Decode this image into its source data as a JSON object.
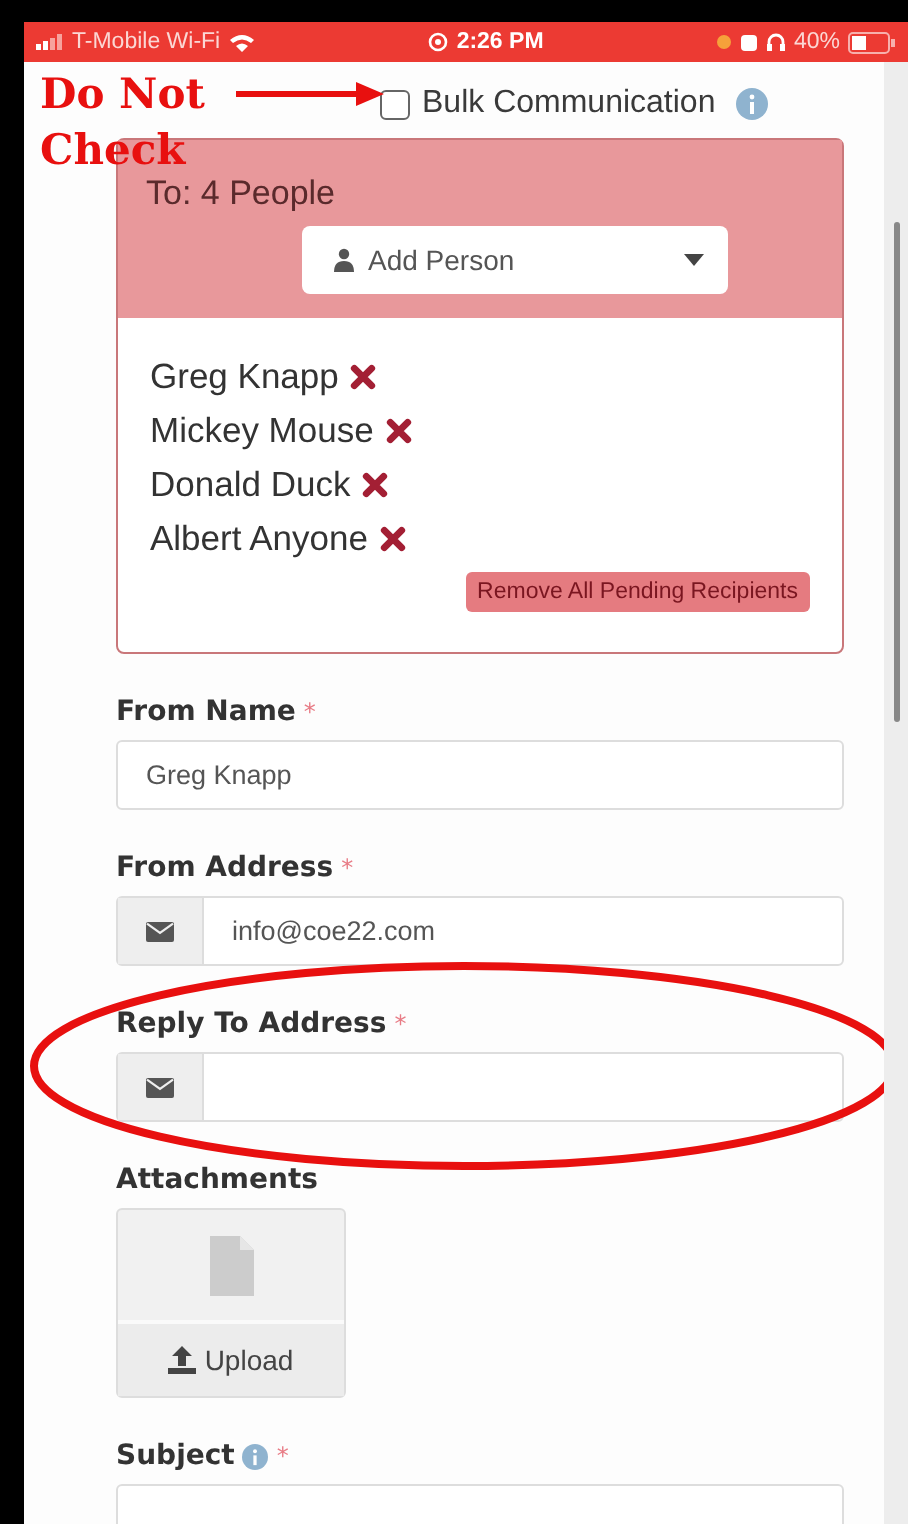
{
  "status_bar": {
    "carrier": "T-Mobile Wi-Fi",
    "time": "2:26 PM",
    "battery": "40%"
  },
  "annotation": {
    "note": "Do Not Check"
  },
  "bulk_communication": {
    "label": "Bulk Communication",
    "checked": false,
    "info": true
  },
  "recipients": {
    "title": "To: 4 People",
    "add_person": "Add Person",
    "people": [
      {
        "name": "Greg Knapp"
      },
      {
        "name": "Mickey Mouse"
      },
      {
        "name": "Donald Duck"
      },
      {
        "name": "Albert Anyone"
      }
    ],
    "remove_all": "Remove All Pending Recipients"
  },
  "fields": [
    {
      "kind": "text",
      "label": "From Name",
      "required_mark": "*",
      "value": "Greg Knapp"
    },
    {
      "kind": "email",
      "label": "From Address",
      "required_mark": "*",
      "value": "info@coe22.com"
    },
    {
      "kind": "email",
      "label": "Reply To Address",
      "required_mark": "*",
      "highlighted": true
    },
    {
      "kind": "upload",
      "label": "Attachments",
      "button": "Upload"
    },
    {
      "kind": "text",
      "label": "Subject",
      "info": true,
      "required_mark": "*"
    }
  ]
}
